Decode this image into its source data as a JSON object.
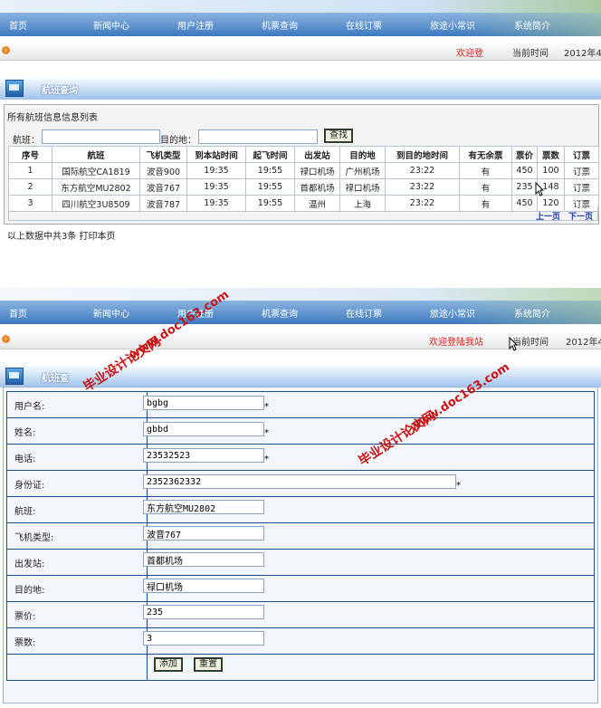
{
  "nav": {
    "items": [
      "首页",
      "新闻中心",
      "用户注册",
      "机票查询",
      "在线订票",
      "旅途小常识",
      "系统简介"
    ]
  },
  "status": {
    "welcome_top": "欢迎登",
    "welcome_bottom": "欢迎登陆我站",
    "time_label": "当前时间",
    "date": "2012年4"
  },
  "section": {
    "title": "航班查询",
    "title_bottom": "航班查"
  },
  "list": {
    "heading": "所有航班信息信息列表",
    "flight_label": "航班：",
    "dest_label": "目的地：",
    "search_button": "查找",
    "columns": [
      "序号",
      "航班",
      "飞机类型",
      "到本站时间",
      "起飞时间",
      "出发站",
      "目的地",
      "到目的地时间",
      "有无余票",
      "票价",
      "票数",
      "订票"
    ],
    "rows": [
      [
        "1",
        "国际航空CA1819",
        "波音900",
        "19:35",
        "19:55",
        "禄口机场",
        "广州机场",
        "23:22",
        "有",
        "450",
        "100",
        "订票"
      ],
      [
        "2",
        "东方航空MU2802",
        "波音767",
        "19:35",
        "19:55",
        "首都机场",
        "禄口机场",
        "23:22",
        "有",
        "235",
        "148",
        "订票"
      ],
      [
        "3",
        "四川航空3U8509",
        "波音787",
        "19:35",
        "19:55",
        "温州",
        "上海",
        "23:22",
        "有",
        "450",
        "120",
        "订票"
      ]
    ],
    "prev": "上一页",
    "next": "下一页",
    "footer": "以上数据中共3条  打印本页"
  },
  "form": {
    "fields": [
      {
        "label": "用户名:",
        "value": "bgbg",
        "required": "*"
      },
      {
        "label": "姓名:",
        "value": "gbbd",
        "required": "*"
      },
      {
        "label": "电话:",
        "value": "23532523",
        "required": "*"
      },
      {
        "label": "身份证:",
        "value": "2352362332",
        "required": "*"
      },
      {
        "label": "航班:",
        "value": "东方航空MU2802",
        "required": ""
      },
      {
        "label": "飞机类型:",
        "value": "波音767",
        "required": ""
      },
      {
        "label": "出发站:",
        "value": "首都机场",
        "required": ""
      },
      {
        "label": "目的地:",
        "value": "禄口机场",
        "required": ""
      },
      {
        "label": "票价:",
        "value": "235",
        "required": ""
      },
      {
        "label": "票数:",
        "value": "3",
        "required": ""
      }
    ],
    "add_button": "添加",
    "reset_button": "重置"
  },
  "watermarks": {
    "url": "www.doc163.com",
    "text": "毕业设计论文网"
  },
  "colors": {
    "nav": "#3c79c0",
    "welcome": "#d42020",
    "watermark": "#c81414"
  }
}
